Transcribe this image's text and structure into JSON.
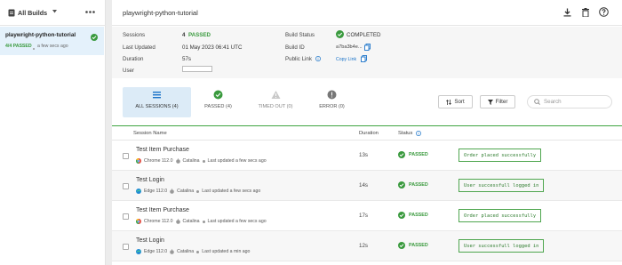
{
  "sidebar": {
    "title": "All Builds",
    "build_name": "playwright-python-tutorial",
    "passed_count": "4/4 PASSED",
    "time_ago": "a few secs ago"
  },
  "header": {
    "title": "playwright-python-tutorial"
  },
  "info": {
    "sessions_label": "Sessions",
    "sessions_value": "4",
    "sessions_status": "PASSED",
    "last_updated_label": "Last Updated",
    "last_updated_value": "01 May 2023 06:41 UTC",
    "duration_label": "Duration",
    "duration_value": "57s",
    "user_label": "User",
    "build_status_label": "Build Status",
    "build_status_value": "COMPLETED",
    "build_id_label": "Build ID",
    "build_id_value": "a7ba3b4e...",
    "public_link_label": "Public Link",
    "copy_link": "Copy Link"
  },
  "tabs": [
    {
      "label": "ALL SESSIONS (4)"
    },
    {
      "label": "PASSED (4)"
    },
    {
      "label": "TIMED OUT (0)"
    },
    {
      "label": "ERROR (0)"
    }
  ],
  "toolbar": {
    "sort": "Sort",
    "filter": "Filter",
    "search_placeholder": "Search"
  },
  "table": {
    "col_session": "Session Name",
    "col_duration": "Duration",
    "col_status": "Status"
  },
  "rows": [
    {
      "name": "Test Item Purchase",
      "browser": "Chrome 112.0",
      "os": "Catalina",
      "updated": "Last updated a few secs ago",
      "duration": "13s",
      "status": "PASSED",
      "message": "Order placed successfully"
    },
    {
      "name": "Test Login",
      "browser": "Edge 112.0",
      "os": "Catalina",
      "updated": "Last updated a few secs ago",
      "duration": "14s",
      "status": "PASSED",
      "message": "User successfull logged in"
    },
    {
      "name": "Test Item Purchase",
      "browser": "Chrome 112.0",
      "os": "Catalina",
      "updated": "Last updated a few secs ago",
      "duration": "17s",
      "status": "PASSED",
      "message": "Order placed successfully"
    },
    {
      "name": "Test Login",
      "browser": "Edge 112.0",
      "os": "Catalina",
      "updated": "Last updated a min ago",
      "duration": "12s",
      "status": "PASSED",
      "message": "User successfull logged in"
    }
  ],
  "colors": {
    "accent": "#3fa442",
    "selected_bg": "#e4f1fb",
    "link": "#1a73c9"
  }
}
